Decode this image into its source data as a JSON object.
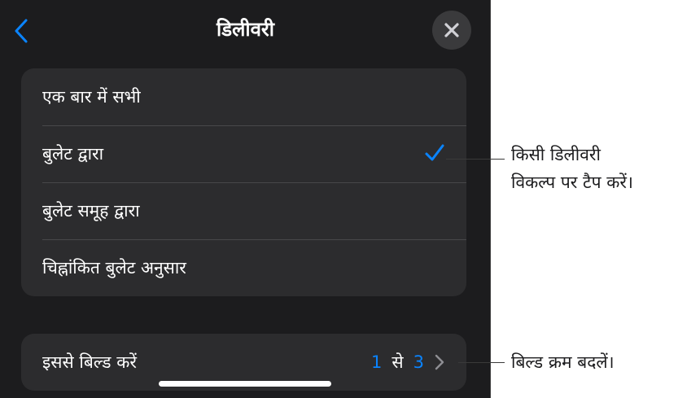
{
  "header": {
    "title": "डिलीवरी",
    "back_icon": "chevron-left-icon",
    "close_icon": "close-icon"
  },
  "delivery_options": [
    {
      "label": "एक बार में सभी",
      "selected": false
    },
    {
      "label": "बुलेट द्वारा",
      "selected": true
    },
    {
      "label": "बुलेट समूह द्वारा",
      "selected": false
    },
    {
      "label": "चिह्नांकित बुलेट अनुसार",
      "selected": false
    }
  ],
  "build_from": {
    "label": "इससे बिल्ड करें",
    "start": "1",
    "word": "से",
    "end": "3",
    "chevron_icon": "chevron-right-icon"
  },
  "callouts": {
    "option_line1": "किसी डिलीवरी",
    "option_line2": "विकल्प पर टैप करें।",
    "build_order": "बिल्ड क्रम बदलें।"
  },
  "colors": {
    "accent": "#0a84ff",
    "panel_bg": "#1c1c1e",
    "group_bg": "#2c2c2e"
  }
}
